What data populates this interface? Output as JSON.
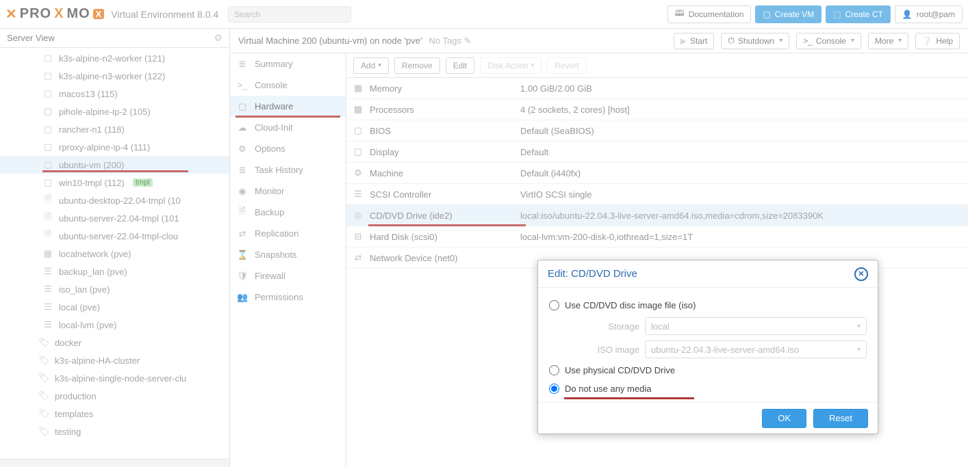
{
  "header": {
    "logo_prefix": "PRO",
    "logo_x": "X",
    "logo_mo": "MO",
    "version_label": "Virtual Environment 8.0.4",
    "search_placeholder": "Search",
    "btn_doc": "Documentation",
    "btn_create_vm": "Create VM",
    "btn_create_ct": "Create CT",
    "btn_user": "root@pam"
  },
  "sidebar": {
    "view_label": "Server View",
    "items": [
      {
        "icon": "▢",
        "label": "k3s-alpine-n2-worker (121)"
      },
      {
        "icon": "▢",
        "label": "k3s-alpine-n3-worker (122)"
      },
      {
        "icon": "▢",
        "label": "macos13 (115)"
      },
      {
        "icon": "▢",
        "label": "pihole-alpine-ip-2 (105)"
      },
      {
        "icon": "▢",
        "label": "rancher-n1 (118)"
      },
      {
        "icon": "▢",
        "label": "rproxy-alpine-ip-4 (111)"
      },
      {
        "icon": "▢",
        "label": "ubuntu-vm (200)",
        "selected": true,
        "underline": true
      },
      {
        "icon": "▢",
        "label": "win10-tmpl (112)",
        "tmpl": "tmpl"
      },
      {
        "icon": "🗎",
        "label": "ubuntu-desktop-22.04-tmpl (10"
      },
      {
        "icon": "🗎",
        "label": "ubuntu-server-22.04-tmpl (101"
      },
      {
        "icon": "🗎",
        "label": "ubuntu-server-22.04-tmpl-clou"
      },
      {
        "icon": "▦",
        "label": "localnetwork (pve)"
      },
      {
        "icon": "☰",
        "label": "backup_lan (pve)"
      },
      {
        "icon": "☰",
        "label": "iso_lan (pve)"
      },
      {
        "icon": "☰",
        "label": "local (pve)"
      },
      {
        "icon": "☰",
        "label": "local-lvm (pve)"
      }
    ],
    "tags": [
      {
        "label": "docker"
      },
      {
        "label": "k3s-alpine-HA-cluster"
      },
      {
        "label": "k3s-alpine-single-node-server-clu"
      },
      {
        "label": "production"
      },
      {
        "label": "templates"
      },
      {
        "label": "testing"
      }
    ]
  },
  "vmtitle": {
    "title": "Virtual Machine 200 (ubuntu-vm) on node 'pve'",
    "no_tags": "No Tags",
    "btn_start": "Start",
    "btn_shutdown": "Shutdown",
    "btn_console": "Console",
    "btn_more": "More",
    "btn_help": "Help"
  },
  "menu": [
    {
      "icon": "≣",
      "label": "Summary"
    },
    {
      "icon": ">_",
      "label": "Console"
    },
    {
      "icon": "▢",
      "label": "Hardware",
      "selected": true,
      "underline": true
    },
    {
      "icon": "☁",
      "label": "Cloud-Init"
    },
    {
      "icon": "⚙",
      "label": "Options"
    },
    {
      "icon": "≣",
      "label": "Task History"
    },
    {
      "icon": "◉",
      "label": "Monitor"
    },
    {
      "icon": "🗎",
      "label": "Backup"
    },
    {
      "icon": "⇄",
      "label": "Replication"
    },
    {
      "icon": "⌛",
      "label": "Snapshots"
    },
    {
      "icon": "🛡",
      "label": "Firewall"
    },
    {
      "icon": "👥",
      "label": "Permissions"
    }
  ],
  "hw_toolbar": {
    "add": "Add",
    "remove": "Remove",
    "edit": "Edit",
    "disk": "Disk Action",
    "revert": "Revert"
  },
  "hardware": [
    {
      "icon": "▦",
      "key": "Memory",
      "val": "1.00 GiB/2.00 GiB"
    },
    {
      "icon": "▩",
      "key": "Processors",
      "val": "4 (2 sockets, 2 cores) [host]"
    },
    {
      "icon": "▢",
      "key": "BIOS",
      "val": "Default (SeaBIOS)"
    },
    {
      "icon": "▢",
      "key": "Display",
      "val": "Default"
    },
    {
      "icon": "⚙",
      "key": "Machine",
      "val": "Default (i440fx)"
    },
    {
      "icon": "☰",
      "key": "SCSI Controller",
      "val": "VirtIO SCSI single"
    },
    {
      "icon": "◎",
      "key": "CD/DVD Drive (ide2)",
      "val": "local:iso/ubuntu-22.04.3-live-server-amd64.iso,media=cdrom,size=2083390K",
      "selected": true,
      "underline": true
    },
    {
      "icon": "⊟",
      "key": "Hard Disk (scsi0)",
      "val": "local-lvm:vm-200-disk-0,iothread=1,size=1T"
    },
    {
      "icon": "⇄",
      "key": "Network Device (net0)",
      "val": ""
    }
  ],
  "dialog": {
    "title": "Edit: CD/DVD Drive",
    "opt_iso": "Use CD/DVD disc image file (iso)",
    "storage_label": "Storage",
    "storage_value": "local",
    "iso_label": "ISO image",
    "iso_value": "ubuntu-22.04.3-live-server-amd64.iso",
    "opt_phys": "Use physical CD/DVD Drive",
    "opt_none": "Do not use any media",
    "btn_ok": "OK",
    "btn_reset": "Reset"
  }
}
